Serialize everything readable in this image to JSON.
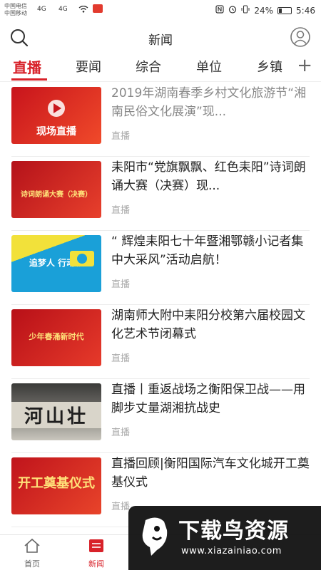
{
  "status_bar": {
    "carrier_1": "中国电信",
    "carrier_2": "中国移动",
    "signal_1": "4G",
    "signal_2": "4G",
    "battery": "24%",
    "time": "5:46"
  },
  "header": {
    "title": "新闻",
    "search_icon": "search-icon",
    "user_icon": "user-icon"
  },
  "tabs": [
    {
      "label": "直播",
      "active": true
    },
    {
      "label": "要闻",
      "active": false
    },
    {
      "label": "综合",
      "active": false
    },
    {
      "label": "单位",
      "active": false
    },
    {
      "label": "乡镇",
      "active": false
    }
  ],
  "tabs_more": "+",
  "news": [
    {
      "title": "2019年湖南春季乡村文化旅游节“湘南民俗文化展演”现...",
      "tag": "直播",
      "read": true,
      "thumb_text": "现场直播",
      "thumb_colors": [
        "#c8141c",
        "#f04a2a"
      ]
    },
    {
      "title": "耒阳市“党旗飘飘、红色耒阳”诗词朗诵大赛（决赛）现...",
      "tag": "直播",
      "read": false,
      "thumb_text": "诗词朗诵大赛（决赛）",
      "thumb_colors": [
        "#b4121a",
        "#e8402c"
      ]
    },
    {
      "title": "“ 辉煌耒阳七十年暨湘鄂赣小记者集中大采风”活动启航！",
      "tag": "直播",
      "read": false,
      "thumb_text": "追梦人 行动派",
      "thumb_colors": [
        "#1aa0d8",
        "#f2e13a"
      ]
    },
    {
      "title": "湖南师大附中耒阳分校第六届校园文化艺术节闭幕式",
      "tag": "直播",
      "read": false,
      "thumb_text": "少年春涌新时代",
      "thumb_colors": [
        "#b81018",
        "#e63a2a"
      ]
    },
    {
      "title": "直播丨重返战场之衡阳保卫战——用脚步丈量湖湘抗战史",
      "tag": "直播",
      "read": false,
      "thumb_text": "河山壮",
      "thumb_colors": [
        "#4a4a48",
        "#c9c6bd"
      ]
    },
    {
      "title": "直播回顾|衡阳国际汽车文化城开工奠基仪式",
      "tag": "直播",
      "read": false,
      "thumb_text": "开工奠基仪式",
      "thumb_colors": [
        "#c0141c",
        "#e8442a"
      ]
    }
  ],
  "bottom_nav": [
    {
      "label": "首页",
      "icon": "home-icon",
      "active": false
    },
    {
      "label": "新闻",
      "icon": "news-icon",
      "active": true
    }
  ],
  "watermark": {
    "name": "下载鸟资源",
    "url": "www.xiazainiao.com"
  },
  "colors": {
    "accent": "#d8222a"
  }
}
